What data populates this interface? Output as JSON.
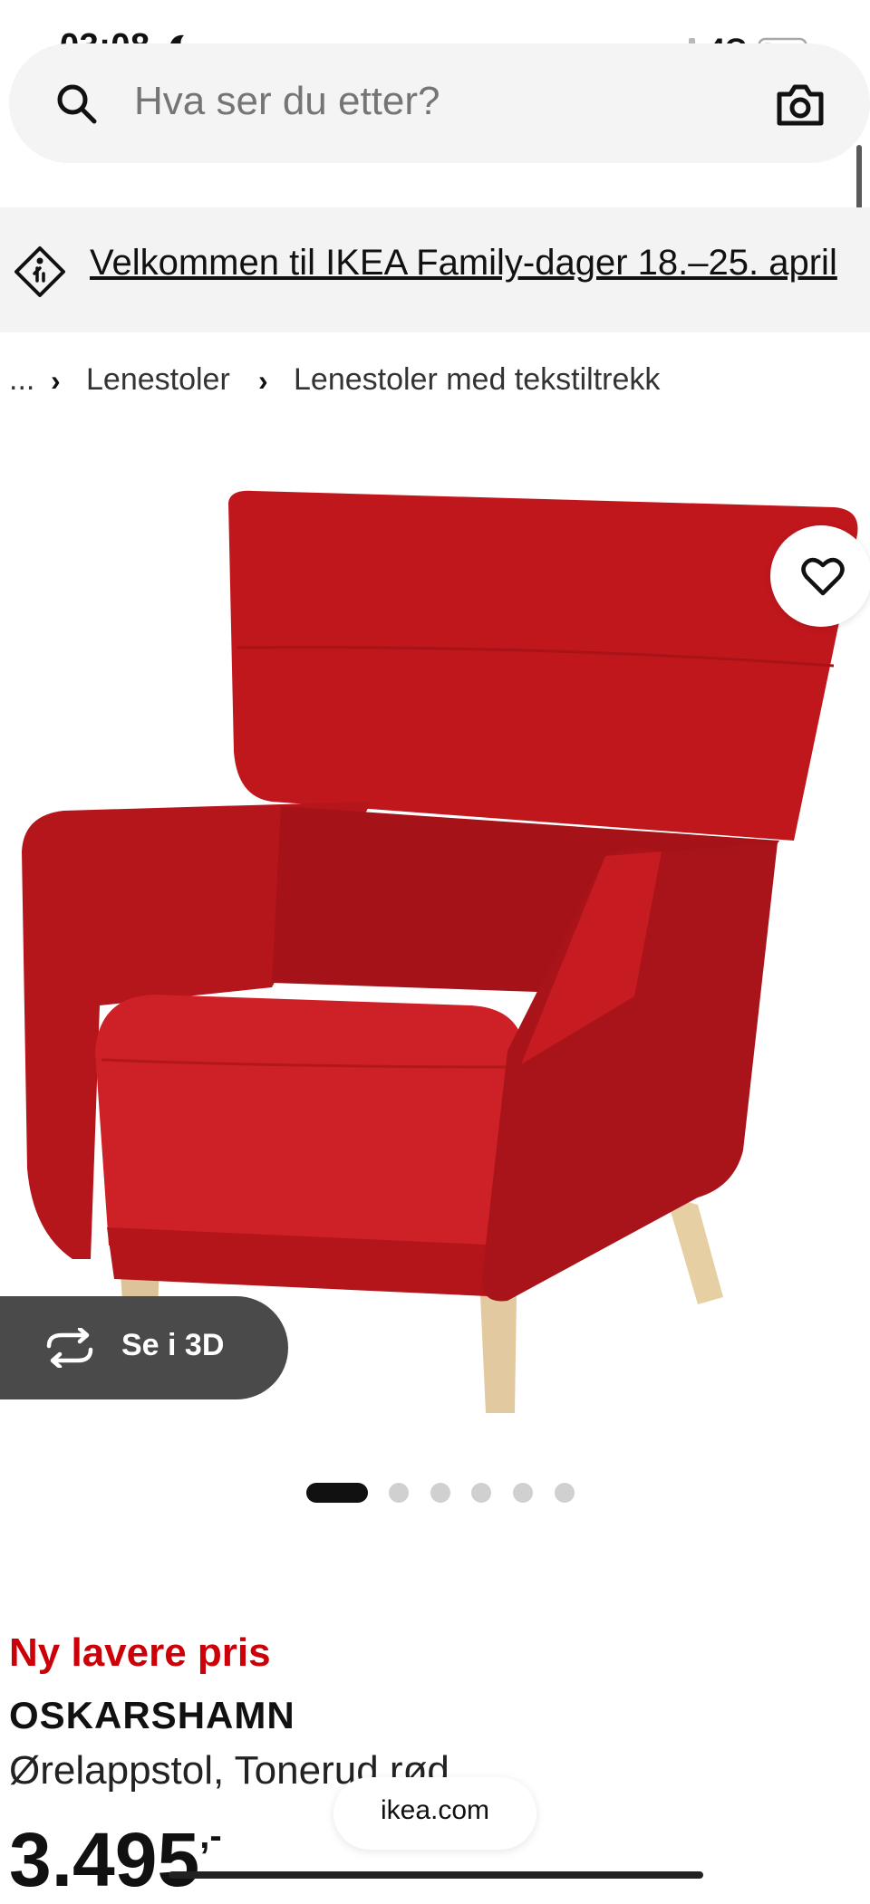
{
  "status_bar": {
    "time": "03:08",
    "network": "4G"
  },
  "search": {
    "placeholder": "Hva ser du etter?"
  },
  "promo": {
    "text": "Velkommen til IKEA Family-dager 18.–25. april"
  },
  "breadcrumb": {
    "items": [
      "...",
      "Lenestoler",
      "Lenestoler med tekstiltrekk"
    ]
  },
  "gallery": {
    "view_3d_label": "Se i 3D",
    "total_images": 6,
    "active_index": 0
  },
  "product": {
    "badge": "Ny lavere pris",
    "name": "OSKARSHAMN",
    "description": "Ørelappstol, Tonerud rød",
    "price": "3.495",
    "price_suffix": ",-"
  },
  "browser": {
    "url": "ikea.com"
  },
  "colors": {
    "accent_red": "#cc0008",
    "chair_red": "#c0171d"
  }
}
